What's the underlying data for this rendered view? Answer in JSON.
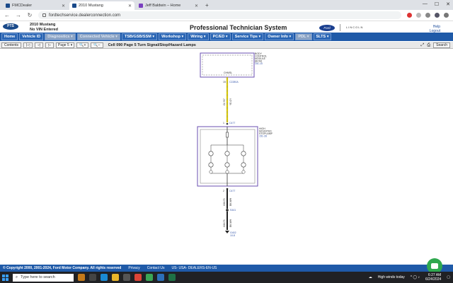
{
  "browser": {
    "tabs": [
      {
        "label": "FMCDealer",
        "active": false,
        "color": "#1a4a8a"
      },
      {
        "label": "2010 Mustang",
        "active": true,
        "color": "#1a4a8a"
      },
      {
        "label": "Jeff Baldwin – Home",
        "active": false,
        "color": "#7a3fbf"
      }
    ],
    "new_tab": "+",
    "url": "fordtechservice.dealerconnection.com"
  },
  "header": {
    "logo": "PTS",
    "vehicle_line1": "2010 Mustang",
    "vehicle_line2": "No VIN Entered",
    "title": "Professional Technician System",
    "ford_logo": "Ford",
    "lincoln": "LINCOLN",
    "help": "Help",
    "logout": "Logout"
  },
  "menu": [
    {
      "label": "Home",
      "disabled": false
    },
    {
      "label": "Vehicle ID",
      "disabled": false
    },
    {
      "label": "Diagnostics ▾",
      "disabled": true
    },
    {
      "label": "Connected Vehicle ▾",
      "disabled": true
    },
    {
      "label": "TSB/GSB/SSM ▾",
      "disabled": false
    },
    {
      "label": "Workshop ▾",
      "disabled": false
    },
    {
      "label": "Wiring ▾",
      "disabled": false
    },
    {
      "label": "PC/ED ▾",
      "disabled": false
    },
    {
      "label": "Service Tips ▾",
      "disabled": false
    },
    {
      "label": "Owner Info ▾",
      "disabled": false
    },
    {
      "label": "PDL ▾",
      "disabled": true
    },
    {
      "label": "SLTS ▾",
      "disabled": false
    }
  ],
  "toolbar": {
    "contents": "Contents",
    "page_select": "Page 5",
    "title": "Cell 090 Page 5 Turn Signal/Stop/Hazard Lamps",
    "search": "Search"
  },
  "diagram": {
    "bcm_label1": "BODY",
    "bcm_label2": "CONTROL",
    "bcm_label3": "MODULE",
    "bcm_label4": "(BCM)",
    "bcm_ref": "151-10",
    "bcm_chan": "CHMSL",
    "pin_top": "15",
    "conn_top": "C2280A",
    "wire1_label": "CLY57",
    "wire1_color": "YE-GY",
    "pin_mid": "1",
    "conn_mid": "C477",
    "lamp_label1": "HIGH",
    "lamp_label2": "MOUNTED",
    "lamp_label3": "STOPLAMP",
    "lamp_ref": "151-28",
    "pin_bot": "2",
    "conn_bot": "C477",
    "wire2_label": "GD175",
    "wire2_color": "BK-WH",
    "splice": "S441",
    "wire3_label": "GD175",
    "wire3_color": "BK-WH",
    "ground": "G402",
    "ground_ref": "10-8"
  },
  "footer": {
    "copyright": "© Copyright 2000, 2001-2024, Ford Motor Company. All rights reserved",
    "privacy": "Privacy",
    "contact": "Contact Us",
    "locale": "US- USA- DEALERS-EN-US"
  },
  "taskbar": {
    "search_placeholder": "Type here to search",
    "weather": "High winds today",
    "time": "6:27 AM",
    "date": "6/24/2024"
  }
}
